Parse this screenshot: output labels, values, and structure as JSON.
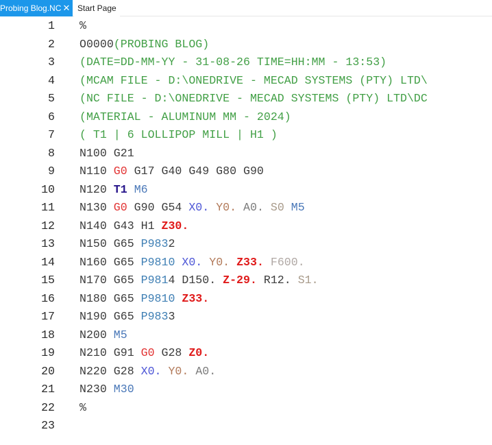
{
  "tabs": [
    {
      "label": "Probing Blog.NC",
      "active": true,
      "close_icon": "close-icon"
    },
    {
      "label": "Start Page",
      "active": false
    }
  ],
  "colors": {
    "tab_active_bg": "#1c97ea",
    "comment": "#43a047",
    "g0_rapid": "#e23333",
    "z_value": "#e01b1b",
    "tool": "#26148a",
    "m_code": "#4a78b8",
    "p_program": "#3f7fb4",
    "x_axis": "#4c55d6",
    "y_axis": "#b27a5a"
  },
  "editor": {
    "lines": [
      {
        "num": "1",
        "tokens": [
          {
            "text": "%",
            "kind": "plain"
          }
        ]
      },
      {
        "num": "2",
        "tokens": [
          {
            "text": "O0000",
            "kind": "plain"
          },
          {
            "text": "(PROBING BLOG)",
            "kind": "comment"
          }
        ]
      },
      {
        "num": "3",
        "tokens": [
          {
            "text": "(DATE=DD-MM-YY - 31-08-26 TIME=HH:MM - 13:53)",
            "kind": "comment"
          }
        ]
      },
      {
        "num": "4",
        "tokens": [
          {
            "text": "(MCAM FILE - D:\\ONEDRIVE - MECAD SYSTEMS (PTY) LTD\\",
            "kind": "comment"
          }
        ]
      },
      {
        "num": "5",
        "tokens": [
          {
            "text": "(NC FILE - D:\\ONEDRIVE - MECAD SYSTEMS (PTY) LTD\\DC",
            "kind": "comment"
          }
        ]
      },
      {
        "num": "6",
        "tokens": [
          {
            "text": "(MATERIAL - ALUMINUM MM - 2024)",
            "kind": "comment"
          }
        ]
      },
      {
        "num": "7",
        "tokens": [
          {
            "text": "( T1 | 6 LOLLIPOP MILL | H1 )",
            "kind": "comment"
          }
        ]
      },
      {
        "num": "8",
        "tokens": [
          {
            "text": "N100 G21",
            "kind": "plain"
          }
        ]
      },
      {
        "num": "9",
        "tokens": [
          {
            "text": "N110 ",
            "kind": "plain"
          },
          {
            "text": "G0",
            "kind": "red"
          },
          {
            "text": " G17 G40 G49 G80 G90",
            "kind": "plain"
          }
        ]
      },
      {
        "num": "10",
        "tokens": [
          {
            "text": "N120 ",
            "kind": "plain"
          },
          {
            "text": "T1",
            "kind": "tool"
          },
          {
            "text": " ",
            "kind": "plain"
          },
          {
            "text": "M6",
            "kind": "m"
          }
        ]
      },
      {
        "num": "11",
        "tokens": [
          {
            "text": "N130 ",
            "kind": "plain"
          },
          {
            "text": "G0",
            "kind": "red"
          },
          {
            "text": " G90 G54 ",
            "kind": "plain"
          },
          {
            "text": "X0.",
            "kind": "x"
          },
          {
            "text": " ",
            "kind": "plain"
          },
          {
            "text": "Y0.",
            "kind": "y"
          },
          {
            "text": " ",
            "kind": "plain"
          },
          {
            "text": "A0.",
            "kind": "a"
          },
          {
            "text": " ",
            "kind": "plain"
          },
          {
            "text": "S0",
            "kind": "s"
          },
          {
            "text": " ",
            "kind": "plain"
          },
          {
            "text": "M5",
            "kind": "m"
          }
        ]
      },
      {
        "num": "12",
        "tokens": [
          {
            "text": "N140 G43 H1 ",
            "kind": "plain"
          },
          {
            "text": "Z30.",
            "kind": "redbold"
          }
        ]
      },
      {
        "num": "13",
        "tokens": [
          {
            "text": "N150 G65 ",
            "kind": "plain"
          },
          {
            "text": "P983",
            "kind": "p"
          },
          {
            "text": "2",
            "kind": "plain"
          }
        ]
      },
      {
        "num": "14",
        "tokens": [
          {
            "text": "N160 G65 ",
            "kind": "plain"
          },
          {
            "text": "P9810",
            "kind": "p"
          },
          {
            "text": " ",
            "kind": "plain"
          },
          {
            "text": "X0.",
            "kind": "x"
          },
          {
            "text": " ",
            "kind": "plain"
          },
          {
            "text": "Y0.",
            "kind": "y"
          },
          {
            "text": " ",
            "kind": "plain"
          },
          {
            "text": "Z33.",
            "kind": "redbold"
          },
          {
            "text": " ",
            "kind": "plain"
          },
          {
            "text": "F600.",
            "kind": "f"
          }
        ]
      },
      {
        "num": "15",
        "tokens": [
          {
            "text": "N170 G65 ",
            "kind": "plain"
          },
          {
            "text": "P981",
            "kind": "p"
          },
          {
            "text": "4 D150. ",
            "kind": "plain"
          },
          {
            "text": "Z-29.",
            "kind": "redbold"
          },
          {
            "text": " R12. ",
            "kind": "plain"
          },
          {
            "text": "S1.",
            "kind": "s"
          }
        ]
      },
      {
        "num": "16",
        "tokens": [
          {
            "text": "N180 G65 ",
            "kind": "plain"
          },
          {
            "text": "P9810",
            "kind": "p"
          },
          {
            "text": " ",
            "kind": "plain"
          },
          {
            "text": "Z33.",
            "kind": "redbold"
          }
        ]
      },
      {
        "num": "17",
        "tokens": [
          {
            "text": "N190 G65 ",
            "kind": "plain"
          },
          {
            "text": "P983",
            "kind": "p"
          },
          {
            "text": "3",
            "kind": "plain"
          }
        ]
      },
      {
        "num": "18",
        "tokens": [
          {
            "text": "N200 ",
            "kind": "plain"
          },
          {
            "text": "M5",
            "kind": "m"
          }
        ]
      },
      {
        "num": "19",
        "tokens": [
          {
            "text": "N210 G91 ",
            "kind": "plain"
          },
          {
            "text": "G0",
            "kind": "red"
          },
          {
            "text": " G28 ",
            "kind": "plain"
          },
          {
            "text": "Z0.",
            "kind": "redbold"
          }
        ]
      },
      {
        "num": "20",
        "tokens": [
          {
            "text": "N220 G28 ",
            "kind": "plain"
          },
          {
            "text": "X0.",
            "kind": "x"
          },
          {
            "text": " ",
            "kind": "plain"
          },
          {
            "text": "Y0.",
            "kind": "y"
          },
          {
            "text": " ",
            "kind": "plain"
          },
          {
            "text": "A0.",
            "kind": "a"
          }
        ]
      },
      {
        "num": "21",
        "tokens": [
          {
            "text": "N230 ",
            "kind": "plain"
          },
          {
            "text": "M30",
            "kind": "m"
          }
        ]
      },
      {
        "num": "22",
        "tokens": [
          {
            "text": "%",
            "kind": "plain"
          }
        ]
      },
      {
        "num": "23",
        "tokens": []
      }
    ]
  }
}
